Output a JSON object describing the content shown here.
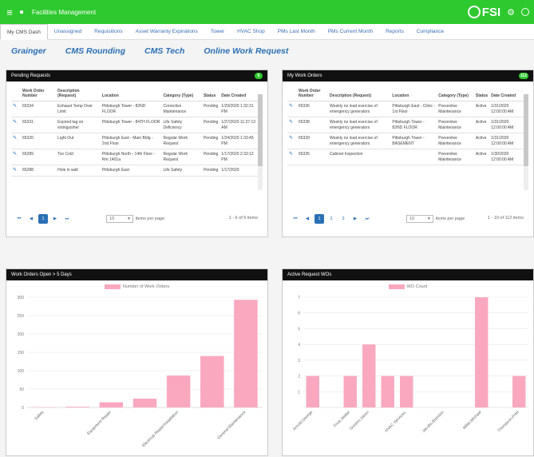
{
  "header": {
    "app_title": "Facilities Management",
    "brand": "FSI",
    "accent": "#2ec92e"
  },
  "tabs": [
    "My CMS Dash",
    "Unassigned",
    "Requisitions",
    "Asset Warranty Expirations",
    "Tower",
    "HVAC Shop",
    "PMs Last Month",
    "PMs Current Month",
    "Reports",
    "Compliance"
  ],
  "links": [
    "Grainger",
    "CMS Rounding",
    "CMS Tech",
    "Online Work Request"
  ],
  "pending": {
    "title": "Pending Requests",
    "badge": "6",
    "columns": [
      "Work Order Number",
      "Description (Request)",
      "Location",
      "Category (Type)",
      "Status",
      "Date Created"
    ],
    "rows": [
      [
        "65334",
        "Exhaust Temp Over Limit",
        "Pittsburgh Tower - 82ND FLOOR",
        "Corrective Maintenance",
        "Pending",
        "1/29/2020 1:32:31 PM"
      ],
      [
        "65331",
        "Expired tag on extinguisher",
        "Pittsburgh Tower - 84TH FLOOR",
        "Life Safety Deficiency",
        "Pending",
        "1/27/2020 11:37:13 AM"
      ],
      [
        "65320",
        "Light Out",
        "Pittsburgh East - Main Bldg - 2nd Floor",
        "Regular Work Request",
        "Pending",
        "1/24/2020 1:33:45 PM"
      ],
      [
        "65289",
        "Too Cold",
        "Pittsburgh North - 14th Floor - Rm 1401a",
        "Regular Work Request",
        "Pending",
        "1/17/2020 2:33:12 PM"
      ],
      [
        "65288",
        "Hole in wall",
        "Pittsburgh East",
        "Life Safety",
        "Pending",
        "1/17/2020"
      ]
    ],
    "page_size": "10",
    "items_per_page": "items per page",
    "pages": [
      "1"
    ],
    "info": "1 - 6 of 6 items"
  },
  "my_orders": {
    "title": "My Work Orders",
    "badge": "112",
    "columns": [
      "Work Order Number",
      "Description (Request)",
      "Location",
      "Category (Type)",
      "Status",
      "Date Created"
    ],
    "rows": [
      [
        "65336",
        "Weekly no load exercise of emergency generators",
        "Pittsburgh East - Clinic - 1st Floor",
        "Preventive Maintenance",
        "Active",
        "1/31/2020 12:00:00 AM"
      ],
      [
        "65338",
        "Weekly no load exercise of emergency generators",
        "Pittsburgh Tower - 82ND FLOOR",
        "Preventive Maintenance",
        "Active",
        "1/31/2020 12:00:00 AM"
      ],
      [
        "65339",
        "Weekly no load exercise of emergency generators",
        "Pittsburgh Tower - BASEMENT",
        "Preventive Maintenance",
        "Active",
        "1/31/2020 12:00:00 AM"
      ],
      [
        "65335",
        "Cabinet Inspection",
        "",
        "Preventive Maintenance",
        "Active",
        "1/30/2020 12:00:00 AM"
      ]
    ],
    "page_size": "10",
    "items_per_page": "items per page",
    "pages": [
      "1",
      "2",
      "3"
    ],
    "info": "1 - 10 of 112 items"
  },
  "chart_data": [
    {
      "type": "bar",
      "title": "Work Orders Open > 5 Days",
      "legend": "Number of Work Orders",
      "categories": [
        "Safety",
        "",
        "Equipment Repair",
        "",
        "Electrical Repair/Installation",
        "",
        "General Maintenance"
      ],
      "values": [
        1,
        2,
        14,
        24,
        87,
        140,
        293
      ],
      "ylim": [
        0,
        300
      ],
      "yticks": [
        0,
        50,
        100,
        150,
        200,
        250,
        300
      ],
      "color": "#f9a8c0"
    },
    {
      "type": "bar",
      "title": "Active Request WOs",
      "legend": "WO Count",
      "categories": [
        "Arnold,George",
        "",
        "Frick,Walter",
        "Gordon,Jason",
        "",
        "HVAC Services,",
        "",
        "Jacobs,Brandon",
        "",
        "Miller,Michael",
        "",
        "Thompson,Fred"
      ],
      "values": [
        2,
        0,
        2,
        4,
        2,
        2,
        0,
        0,
        0,
        7,
        0,
        2
      ],
      "ylim": [
        0,
        7
      ],
      "yticks": [
        1,
        2,
        3,
        4,
        5,
        6,
        7
      ],
      "color": "#f9a8c0"
    }
  ]
}
